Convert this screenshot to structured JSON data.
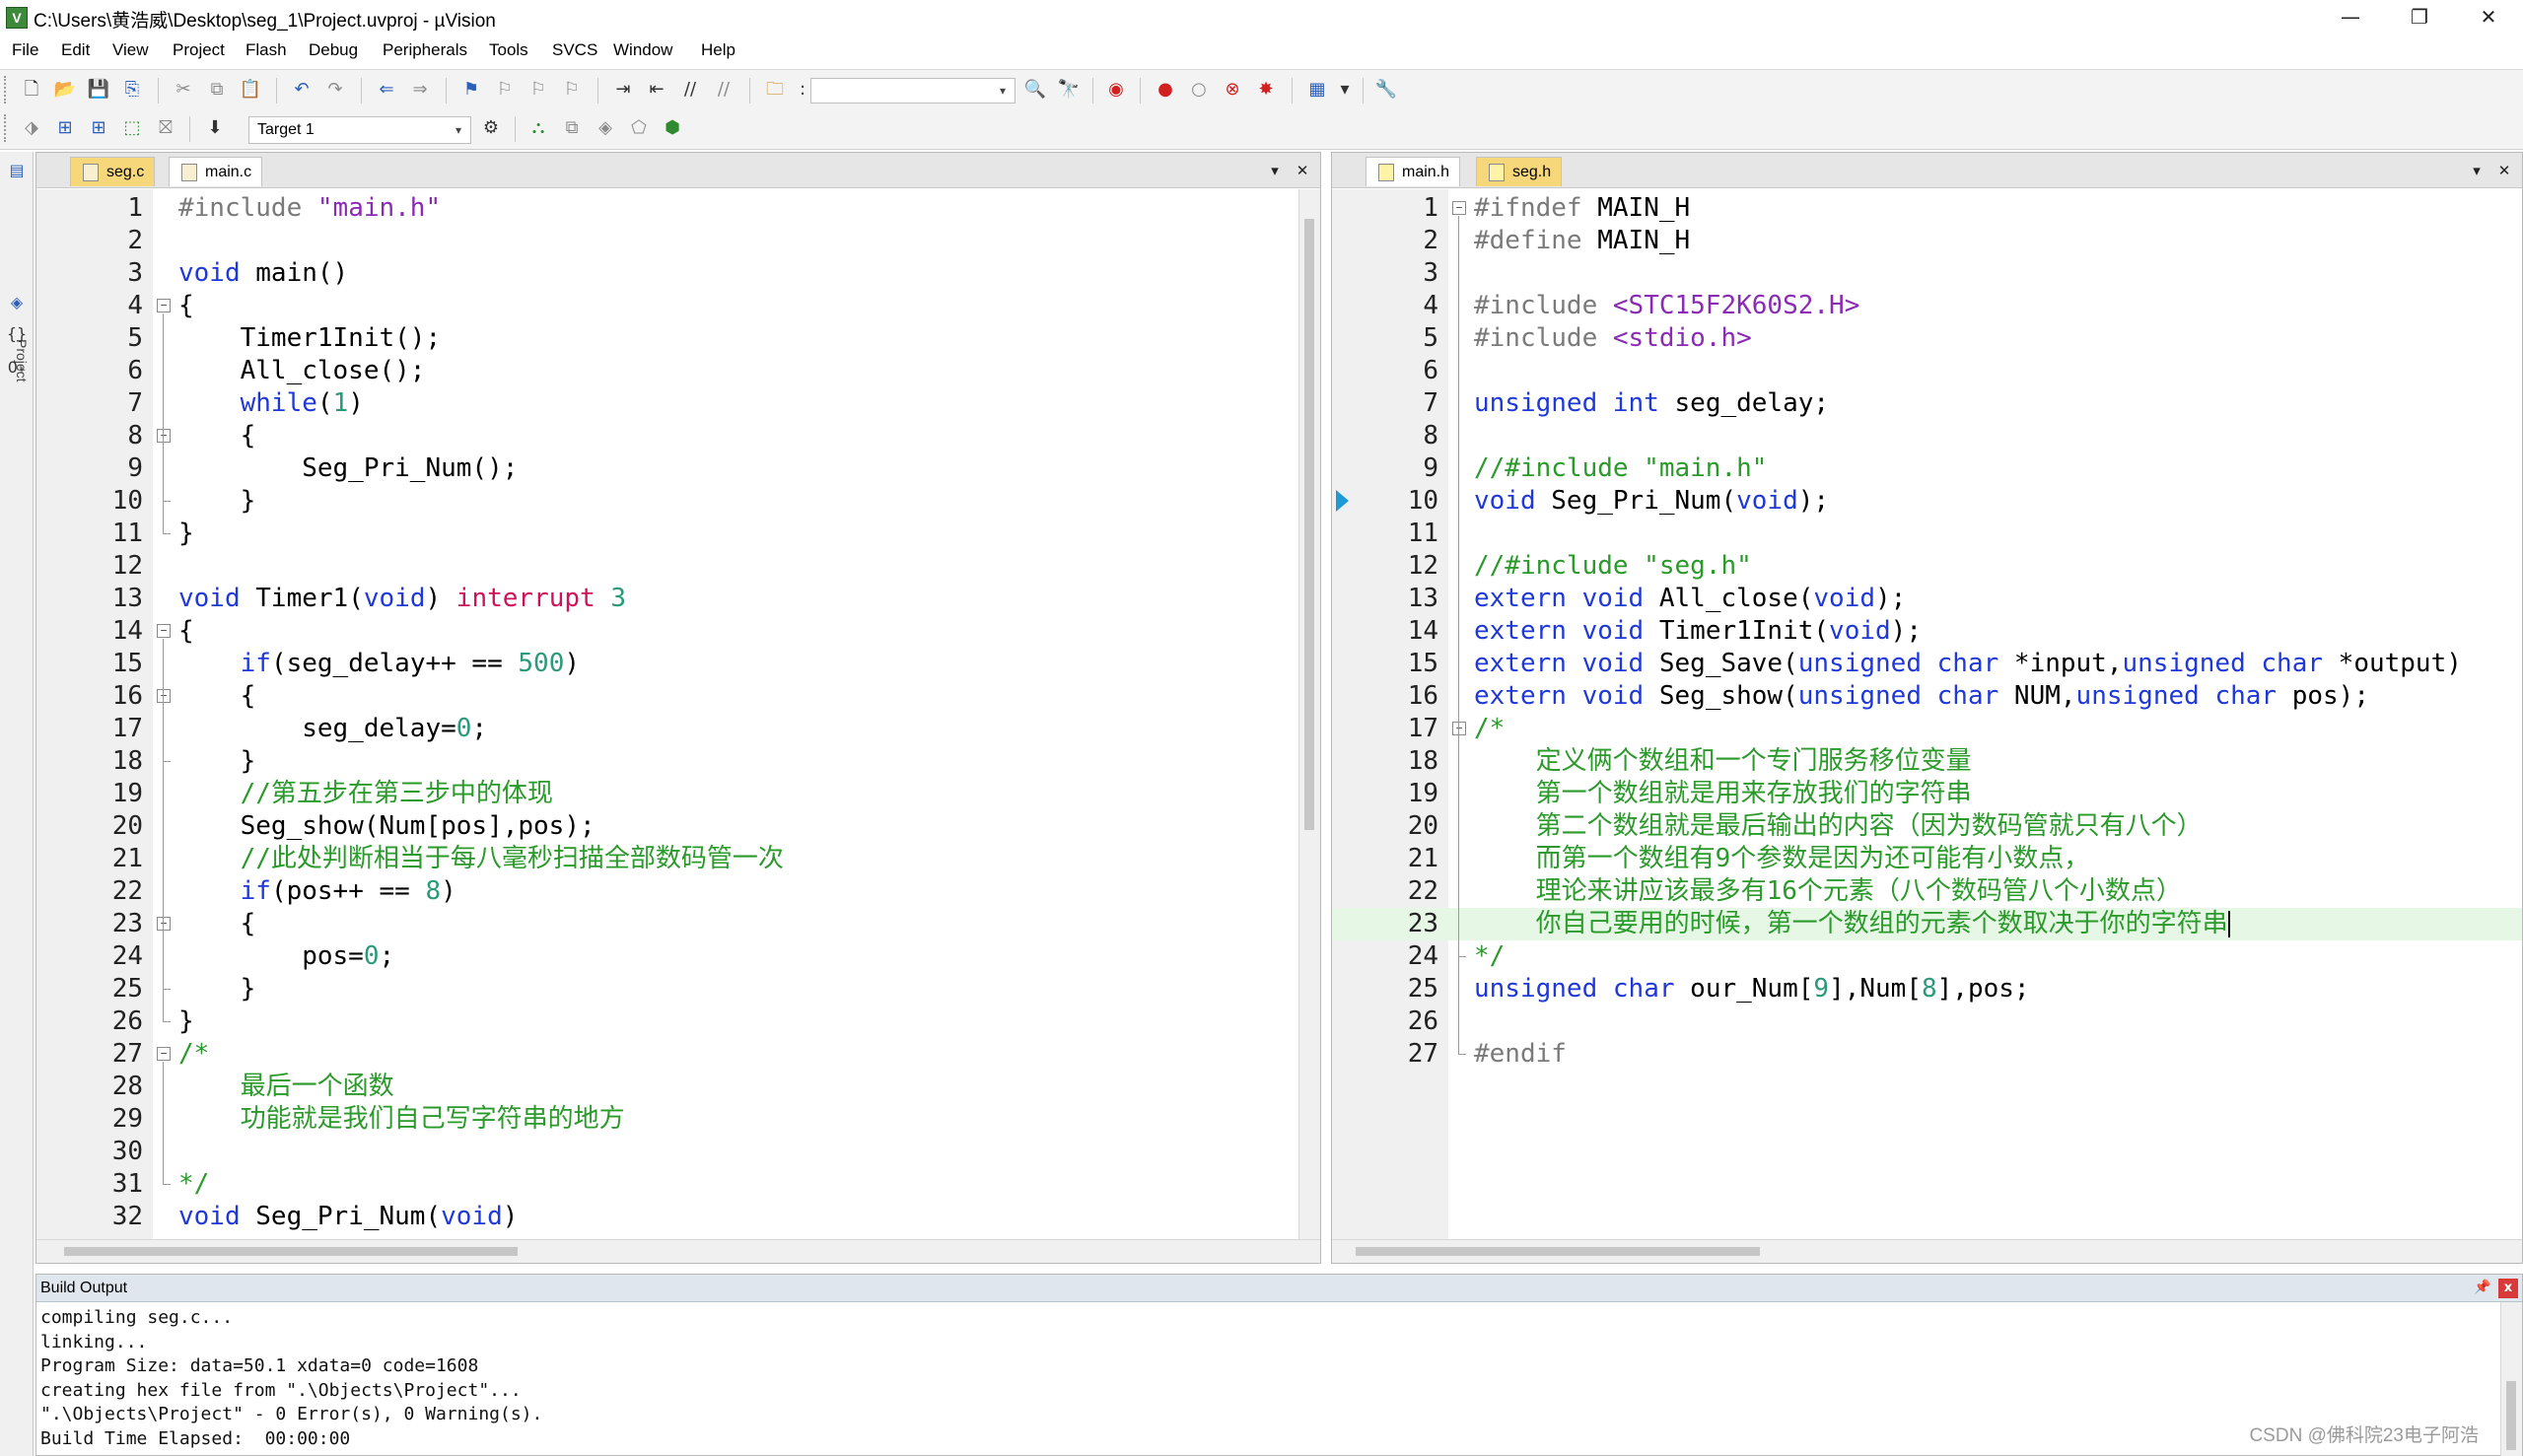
{
  "window": {
    "title": "C:\\Users\\黄浩威\\Desktop\\seg_1\\Project.uvproj - µVision",
    "app_icon_letter": "V",
    "controls": {
      "minimize": "—",
      "restore": "❐",
      "close": "✕"
    }
  },
  "menu": [
    "File",
    "Edit",
    "View",
    "Project",
    "Flash",
    "Debug",
    "Peripherals",
    "Tools",
    "SVCS",
    "Window",
    "Help"
  ],
  "toolbar2": {
    "target_label": "Target 1"
  },
  "left_strip": {
    "project_tab": "Project"
  },
  "left_pane": {
    "tabs": [
      {
        "label": "seg.c"
      },
      {
        "label": "main.c",
        "active": true
      }
    ],
    "lines": [
      {
        "n": "1",
        "segs": [
          [
            "pre",
            "#include "
          ],
          [
            "str",
            "\"main.h\""
          ]
        ]
      },
      {
        "n": "2",
        "segs": []
      },
      {
        "n": "3",
        "segs": [
          [
            "kw",
            "void"
          ],
          [
            "txt",
            " main()"
          ]
        ]
      },
      {
        "n": "4",
        "fold": "open",
        "segs": [
          [
            "txt",
            "{"
          ]
        ]
      },
      {
        "n": "5",
        "segs": [
          [
            "txt",
            "    Timer1Init();"
          ]
        ]
      },
      {
        "n": "6",
        "segs": [
          [
            "txt",
            "    All_close();"
          ]
        ]
      },
      {
        "n": "7",
        "segs": [
          [
            "txt",
            "    "
          ],
          [
            "kw",
            "while"
          ],
          [
            "txt",
            "("
          ],
          [
            "num",
            "1"
          ],
          [
            "txt",
            ")"
          ]
        ]
      },
      {
        "n": "8",
        "fold": "open",
        "segs": [
          [
            "txt",
            "    {"
          ]
        ]
      },
      {
        "n": "9",
        "segs": [
          [
            "txt",
            "        Seg_Pri_Num();"
          ]
        ]
      },
      {
        "n": "10",
        "fold": "end",
        "segs": [
          [
            "txt",
            "    }"
          ]
        ]
      },
      {
        "n": "11",
        "fold": "end",
        "segs": [
          [
            "txt",
            "}"
          ]
        ]
      },
      {
        "n": "12",
        "segs": []
      },
      {
        "n": "13",
        "segs": [
          [
            "kw",
            "void"
          ],
          [
            "txt",
            " Timer1("
          ],
          [
            "kw",
            "void"
          ],
          [
            "txt",
            ") "
          ],
          [
            "int",
            "interrupt"
          ],
          [
            "txt",
            " "
          ],
          [
            "num",
            "3"
          ]
        ]
      },
      {
        "n": "14",
        "fold": "open",
        "segs": [
          [
            "txt",
            "{"
          ]
        ]
      },
      {
        "n": "15",
        "segs": [
          [
            "txt",
            "    "
          ],
          [
            "kw",
            "if"
          ],
          [
            "txt",
            "(seg_delay++ == "
          ],
          [
            "num",
            "500"
          ],
          [
            "txt",
            ")"
          ]
        ]
      },
      {
        "n": "16",
        "fold": "open",
        "segs": [
          [
            "txt",
            "    {"
          ]
        ]
      },
      {
        "n": "17",
        "segs": [
          [
            "txt",
            "        seg_delay="
          ],
          [
            "num",
            "0"
          ],
          [
            "txt",
            ";"
          ]
        ]
      },
      {
        "n": "18",
        "fold": "end",
        "segs": [
          [
            "txt",
            "    }"
          ]
        ]
      },
      {
        "n": "19",
        "segs": [
          [
            "txt",
            "    "
          ],
          [
            "com",
            "//第五步在第三步中的体现"
          ]
        ]
      },
      {
        "n": "20",
        "segs": [
          [
            "txt",
            "    Seg_show(Num[pos],pos);"
          ]
        ]
      },
      {
        "n": "21",
        "segs": [
          [
            "txt",
            "    "
          ],
          [
            "com",
            "//此处判断相当于每八毫秒扫描全部数码管一次"
          ]
        ]
      },
      {
        "n": "22",
        "segs": [
          [
            "txt",
            "    "
          ],
          [
            "kw",
            "if"
          ],
          [
            "txt",
            "(pos++ == "
          ],
          [
            "num",
            "8"
          ],
          [
            "txt",
            ")"
          ]
        ]
      },
      {
        "n": "23",
        "fold": "open",
        "segs": [
          [
            "txt",
            "    {"
          ]
        ]
      },
      {
        "n": "24",
        "segs": [
          [
            "txt",
            "        pos="
          ],
          [
            "num",
            "0"
          ],
          [
            "txt",
            ";"
          ]
        ]
      },
      {
        "n": "25",
        "fold": "end",
        "segs": [
          [
            "txt",
            "    }"
          ]
        ]
      },
      {
        "n": "26",
        "fold": "end",
        "segs": [
          [
            "txt",
            "}"
          ]
        ]
      },
      {
        "n": "27",
        "fold": "open",
        "segs": [
          [
            "com",
            "/*"
          ]
        ]
      },
      {
        "n": "28",
        "segs": [
          [
            "com",
            "    最后一个函数"
          ]
        ]
      },
      {
        "n": "29",
        "segs": [
          [
            "com",
            "    功能就是我们自己写字符串的地方"
          ]
        ]
      },
      {
        "n": "30",
        "segs": []
      },
      {
        "n": "31",
        "fold": "end",
        "segs": [
          [
            "com",
            "*/"
          ]
        ]
      },
      {
        "n": "32",
        "segs": [
          [
            "kw",
            "void"
          ],
          [
            "txt",
            " Seg_Pri_Num("
          ],
          [
            "kw",
            "void"
          ],
          [
            "txt",
            ")"
          ]
        ]
      }
    ]
  },
  "right_pane": {
    "tabs": [
      {
        "label": "main.h",
        "active": true
      },
      {
        "label": "seg.h"
      }
    ],
    "lines": [
      {
        "n": "1",
        "fold": "open",
        "segs": [
          [
            "pre",
            "#ifndef"
          ],
          [
            "txt",
            " MAIN_H"
          ]
        ]
      },
      {
        "n": "2",
        "segs": [
          [
            "pre",
            "#define"
          ],
          [
            "txt",
            " MAIN_H"
          ]
        ]
      },
      {
        "n": "3",
        "segs": []
      },
      {
        "n": "4",
        "segs": [
          [
            "pre",
            "#include "
          ],
          [
            "str",
            "<STC15F2K60S2.H>"
          ]
        ]
      },
      {
        "n": "5",
        "segs": [
          [
            "pre",
            "#include "
          ],
          [
            "str",
            "<stdio.h>"
          ]
        ]
      },
      {
        "n": "6",
        "segs": []
      },
      {
        "n": "7",
        "segs": [
          [
            "kw",
            "unsigned"
          ],
          [
            "txt",
            " "
          ],
          [
            "kw",
            "int"
          ],
          [
            "txt",
            " seg_delay;"
          ]
        ]
      },
      {
        "n": "8",
        "segs": []
      },
      {
        "n": "9",
        "segs": [
          [
            "com",
            "//#include \"main.h\""
          ]
        ]
      },
      {
        "n": "10",
        "marker": true,
        "segs": [
          [
            "kw",
            "void"
          ],
          [
            "txt",
            " Seg_Pri_Num("
          ],
          [
            "kw",
            "void"
          ],
          [
            "txt",
            ");"
          ]
        ]
      },
      {
        "n": "11",
        "segs": []
      },
      {
        "n": "12",
        "segs": [
          [
            "com",
            "//#include \"seg.h\""
          ]
        ]
      },
      {
        "n": "13",
        "segs": [
          [
            "kw",
            "extern"
          ],
          [
            "txt",
            " "
          ],
          [
            "kw",
            "void"
          ],
          [
            "txt",
            " All_close("
          ],
          [
            "kw",
            "void"
          ],
          [
            "txt",
            ");"
          ]
        ]
      },
      {
        "n": "14",
        "segs": [
          [
            "kw",
            "extern"
          ],
          [
            "txt",
            " "
          ],
          [
            "kw",
            "void"
          ],
          [
            "txt",
            " Timer1Init("
          ],
          [
            "kw",
            "void"
          ],
          [
            "txt",
            ");"
          ]
        ]
      },
      {
        "n": "15",
        "segs": [
          [
            "kw",
            "extern"
          ],
          [
            "txt",
            " "
          ],
          [
            "kw",
            "void"
          ],
          [
            "txt",
            " Seg_Save("
          ],
          [
            "kw",
            "unsigned"
          ],
          [
            "txt",
            " "
          ],
          [
            "kw",
            "char"
          ],
          [
            "txt",
            " *input,"
          ],
          [
            "kw",
            "unsigned"
          ],
          [
            "txt",
            " "
          ],
          [
            "kw",
            "char"
          ],
          [
            "txt",
            " *output)"
          ]
        ]
      },
      {
        "n": "16",
        "segs": [
          [
            "kw",
            "extern"
          ],
          [
            "txt",
            " "
          ],
          [
            "kw",
            "void"
          ],
          [
            "txt",
            " Seg_show("
          ],
          [
            "kw",
            "unsigned"
          ],
          [
            "txt",
            " "
          ],
          [
            "kw",
            "char"
          ],
          [
            "txt",
            " NUM,"
          ],
          [
            "kw",
            "unsigned"
          ],
          [
            "txt",
            " "
          ],
          [
            "kw",
            "char"
          ],
          [
            "txt",
            " pos);"
          ]
        ]
      },
      {
        "n": "17",
        "fold": "open",
        "segs": [
          [
            "com",
            "/*"
          ]
        ]
      },
      {
        "n": "18",
        "segs": [
          [
            "com",
            "    定义俩个数组和一个专门服务移位变量"
          ]
        ]
      },
      {
        "n": "19",
        "segs": [
          [
            "com",
            "    第一个数组就是用来存放我们的字符串"
          ]
        ]
      },
      {
        "n": "20",
        "segs": [
          [
            "com",
            "    第二个数组就是最后输出的内容（因为数码管就只有八个）"
          ]
        ]
      },
      {
        "n": "21",
        "segs": [
          [
            "com",
            "    而第一个数组有9个参数是因为还可能有小数点，"
          ]
        ]
      },
      {
        "n": "22",
        "segs": [
          [
            "com",
            "    理论来讲应该最多有16个元素（八个数码管八个小数点）"
          ]
        ]
      },
      {
        "n": "23",
        "current": true,
        "cursor": true,
        "segs": [
          [
            "com",
            "    你自己要用的时候，第一个数组的元素个数取决于你的字符串"
          ]
        ]
      },
      {
        "n": "24",
        "fold": "end",
        "segs": [
          [
            "com",
            "*/"
          ]
        ]
      },
      {
        "n": "25",
        "segs": [
          [
            "kw",
            "unsigned"
          ],
          [
            "txt",
            " "
          ],
          [
            "kw",
            "char"
          ],
          [
            "txt",
            " our_Num["
          ],
          [
            "num",
            "9"
          ],
          [
            "txt",
            "],Num["
          ],
          [
            "num",
            "8"
          ],
          [
            "txt",
            "],pos;"
          ]
        ]
      },
      {
        "n": "26",
        "segs": []
      },
      {
        "n": "27",
        "fold": "end",
        "segs": [
          [
            "pre",
            "#endif"
          ]
        ]
      }
    ]
  },
  "build_output": {
    "title": "Build Output",
    "pin": "📌",
    "close": "x",
    "lines": [
      "compiling seg.c...",
      "linking...",
      "Program Size: data=50.1 xdata=0 code=1608",
      "creating hex file from \".\\Objects\\Project\"...",
      "\".\\Objects\\Project\" - 0 Error(s), 0 Warning(s).",
      "Build Time Elapsed:  00:00:00"
    ]
  },
  "watermark": "CSDN @佛科院23电子阿浩",
  "colors": {
    "keyword": "#1f38d8",
    "preprocessor": "#7a7a7a",
    "string": "#8a2bb4",
    "number": "#2b9a7a",
    "comment": "#2a9a2a",
    "interrupt": "#d0105a",
    "current_line": "#e6f7e6"
  }
}
